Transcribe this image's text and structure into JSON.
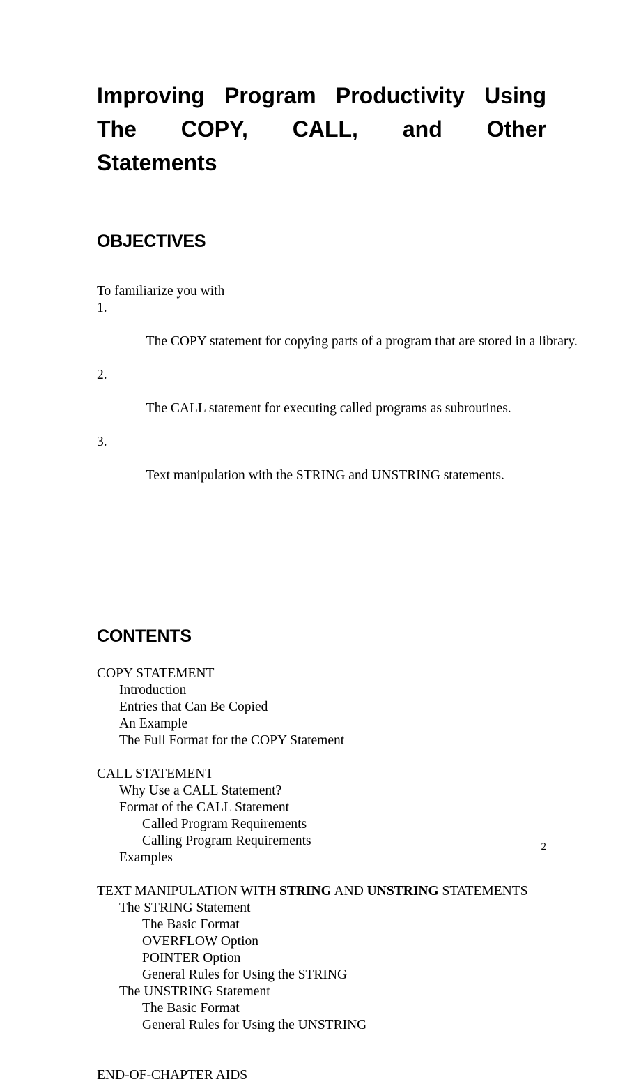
{
  "document": {
    "title_lines": [
      "Improving Program Productivity Using",
      "The COPY, CALL, and Other",
      "Statements"
    ],
    "title_full": "Improving Program Productivity Using The COPY, CALL, and Other Statements",
    "page_number": "2"
  },
  "objectives": {
    "heading": "OBJECTIVES",
    "intro": "To familiarize you with",
    "items": [
      {
        "number": "1.",
        "text": "The COPY statement for copying parts of a program that are stored in a library."
      },
      {
        "number": "2.",
        "text": "The CALL statement for executing called programs as subroutines."
      },
      {
        "number": "3.",
        "text": "Text manipulation with the STRING and UNSTRING statements."
      }
    ]
  },
  "contents": {
    "heading": "CONTENTS",
    "entries": [
      {
        "level": 0,
        "text": "COPY STATEMENT"
      },
      {
        "level": 1,
        "text": "Introduction"
      },
      {
        "level": 1,
        "text": "Entries that Can Be Copied"
      },
      {
        "level": 1,
        "text": "An Example"
      },
      {
        "level": 1,
        "text": "The Full Format for the COPY Statement"
      },
      {
        "level": -1,
        "text": ""
      },
      {
        "level": 0,
        "text": "CALL STATEMENT"
      },
      {
        "level": 1,
        "text": "Why Use a CALL Statement?"
      },
      {
        "level": 1,
        "text": "Format of the CALL Statement"
      },
      {
        "level": 2,
        "text": "Called Program Requirements"
      },
      {
        "level": 2,
        "text": "Calling Program Requirements"
      },
      {
        "level": 1,
        "text": "Examples"
      },
      {
        "level": -1,
        "text": ""
      },
      {
        "level": 0,
        "text": "TEXT MANIPULATION WITH STRING AND UNSTRING STATEMENTS",
        "rich": [
          {
            "t": "TEXT MANIPULATION WITH ",
            "b": false
          },
          {
            "t": "STRING",
            "b": true
          },
          {
            "t": " AND ",
            "b": false
          },
          {
            "t": "UNSTRING",
            "b": true
          },
          {
            "t": " STATEMENTS",
            "b": false
          }
        ]
      },
      {
        "level": 1,
        "text": "The STRING Statement"
      },
      {
        "level": 2,
        "text": "The Basic Format"
      },
      {
        "level": 2,
        "text": "OVERFLOW Option"
      },
      {
        "level": 2,
        "text": "POINTER Option"
      },
      {
        "level": 2,
        "text": "General Rules for Using the STRING"
      },
      {
        "level": 1,
        "text": "The UNSTRING Statement"
      },
      {
        "level": 2,
        "text": "The Basic Format"
      },
      {
        "level": 2,
        "text": "General Rules for Using the UNSTRING"
      },
      {
        "level": -1,
        "text": ""
      },
      {
        "level": -1,
        "text": ""
      },
      {
        "level": 0,
        "text": "END-OF-CHAPTER AIDS"
      }
    ]
  }
}
